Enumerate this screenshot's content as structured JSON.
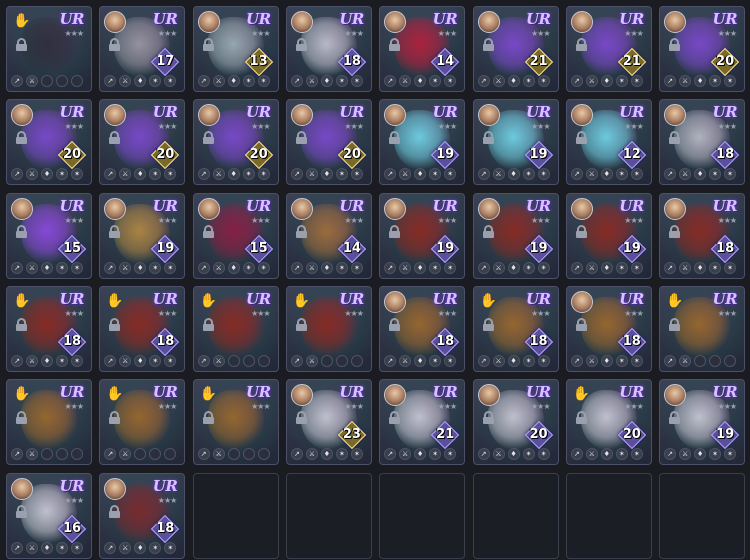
{
  "colors": {
    "background": "#1a1c21",
    "card_border": "#4a5168",
    "rarity_text": "#d9c2ff",
    "badge_purple": "#5a4f9c",
    "badge_gold": "#7a6a2a"
  },
  "items": [
    {
      "rarity": "UR",
      "level": "",
      "icon": "cat-mask-icon",
      "equipped": false,
      "badge": "none",
      "art": "#2b2f3a"
    },
    {
      "rarity": "UR",
      "level": "17",
      "icon": "winged-skull-icon",
      "equipped": true,
      "badge": "purple",
      "art": "#9a9aa4"
    },
    {
      "rarity": "UR",
      "level": "13",
      "icon": "silver-necklace-icon",
      "equipped": true,
      "badge": "gold",
      "art": "#9cb0b5"
    },
    {
      "rarity": "UR",
      "level": "18",
      "icon": "silver-ring-icon",
      "equipped": true,
      "badge": "purple",
      "art": "#bfc4cf"
    },
    {
      "rarity": "UR",
      "level": "14",
      "icon": "ruby-necklace-icon",
      "equipped": true,
      "badge": "purple",
      "art": "#b3203a"
    },
    {
      "rarity": "UR",
      "level": "21",
      "icon": "gem-ring-icon",
      "equipped": true,
      "badge": "gold",
      "art": "#7a4ad0"
    },
    {
      "rarity": "UR",
      "level": "21",
      "icon": "gem-ring-icon",
      "equipped": true,
      "badge": "gold",
      "art": "#7a4ad0"
    },
    {
      "rarity": "UR",
      "level": "20",
      "icon": "gem-ring-icon",
      "equipped": true,
      "badge": "gold",
      "art": "#7a4ad0"
    },
    {
      "rarity": "UR",
      "level": "20",
      "icon": "gem-ring-icon",
      "equipped": true,
      "badge": "gold",
      "art": "#7a4ad0"
    },
    {
      "rarity": "UR",
      "level": "20",
      "icon": "gem-ring-icon",
      "equipped": true,
      "badge": "gold",
      "art": "#7a4ad0"
    },
    {
      "rarity": "UR",
      "level": "20",
      "icon": "gem-ring-icon",
      "equipped": true,
      "badge": "gold",
      "art": "#7a4ad0"
    },
    {
      "rarity": "UR",
      "level": "20",
      "icon": "gem-ring-icon",
      "equipped": true,
      "badge": "gold",
      "art": "#7a4ad0"
    },
    {
      "rarity": "UR",
      "level": "19",
      "icon": "crystal-necklace-icon",
      "equipped": true,
      "badge": "purple",
      "art": "#6fd6e8"
    },
    {
      "rarity": "UR",
      "level": "19",
      "icon": "crystal-necklace-icon",
      "equipped": true,
      "badge": "purple",
      "art": "#6fd6e8"
    },
    {
      "rarity": "UR",
      "level": "12",
      "icon": "crystal-necklace-icon",
      "equipped": true,
      "badge": "purple",
      "art": "#6fd6e8"
    },
    {
      "rarity": "UR",
      "level": "18",
      "icon": "silver-gauntlet-icon",
      "equipped": true,
      "badge": "purple",
      "art": "#b8bcc6"
    },
    {
      "rarity": "UR",
      "level": "15",
      "icon": "purple-bracelet-icon",
      "equipped": true,
      "badge": "purple",
      "art": "#8a4ae0"
    },
    {
      "rarity": "UR",
      "level": "19",
      "icon": "gold-gauntlet-icon",
      "equipped": true,
      "badge": "purple",
      "art": "#b08a40"
    },
    {
      "rarity": "UR",
      "level": "15",
      "icon": "red-glove-icon",
      "equipped": true,
      "badge": "purple",
      "art": "#8a1e40"
    },
    {
      "rarity": "UR",
      "level": "14",
      "icon": "leather-glove-icon",
      "equipped": true,
      "badge": "purple",
      "art": "#a0703a"
    },
    {
      "rarity": "UR",
      "level": "19",
      "icon": "demon-helm-icon",
      "equipped": true,
      "badge": "purple",
      "art": "#8a2a1e"
    },
    {
      "rarity": "UR",
      "level": "19",
      "icon": "demon-helm-icon",
      "equipped": true,
      "badge": "purple",
      "art": "#8a2a1e"
    },
    {
      "rarity": "UR",
      "level": "19",
      "icon": "demon-helm-icon",
      "equipped": true,
      "badge": "purple",
      "art": "#8a2a1e"
    },
    {
      "rarity": "UR",
      "level": "18",
      "icon": "demon-helm-icon",
      "equipped": true,
      "badge": "purple",
      "art": "#8a2a1e"
    },
    {
      "rarity": "UR",
      "level": "18",
      "icon": "demon-helm-icon",
      "equipped": false,
      "badge": "purple",
      "art": "#8a2a1e"
    },
    {
      "rarity": "UR",
      "level": "18",
      "icon": "demon-helm-icon",
      "equipped": false,
      "badge": "purple",
      "art": "#8a2a1e"
    },
    {
      "rarity": "UR",
      "level": "",
      "icon": "demon-helm-icon",
      "equipped": false,
      "badge": "none",
      "art": "#8a2a1e"
    },
    {
      "rarity": "UR",
      "level": "",
      "icon": "demon-helm-icon",
      "equipped": false,
      "badge": "none",
      "art": "#8a2a1e"
    },
    {
      "rarity": "UR",
      "level": "18",
      "icon": "clawed-gauntlet-icon",
      "equipped": true,
      "badge": "purple",
      "art": "#9a6a2a"
    },
    {
      "rarity": "UR",
      "level": "18",
      "icon": "clawed-gauntlet-icon",
      "equipped": false,
      "badge": "purple",
      "art": "#9a6a2a"
    },
    {
      "rarity": "UR",
      "level": "18",
      "icon": "clawed-gauntlet-icon",
      "equipped": true,
      "badge": "purple",
      "art": "#9a6a2a"
    },
    {
      "rarity": "UR",
      "level": "",
      "icon": "clawed-gauntlet-icon",
      "equipped": false,
      "badge": "none",
      "art": "#9a6a2a"
    },
    {
      "rarity": "UR",
      "level": "",
      "icon": "clawed-gauntlet-icon",
      "equipped": false,
      "badge": "none",
      "art": "#9a6a2a"
    },
    {
      "rarity": "UR",
      "level": "",
      "icon": "clawed-gauntlet-icon",
      "equipped": false,
      "badge": "none",
      "art": "#9a6a2a"
    },
    {
      "rarity": "UR",
      "level": "",
      "icon": "clawed-gauntlet-icon",
      "equipped": false,
      "badge": "none",
      "art": "#9a6a2a"
    },
    {
      "rarity": "UR",
      "level": "23",
      "icon": "silver-gauntlet-icon",
      "equipped": true,
      "badge": "gold",
      "art": "#c8ccd6"
    },
    {
      "rarity": "UR",
      "level": "21",
      "icon": "silver-gauntlet-icon",
      "equipped": true,
      "badge": "purple",
      "art": "#c8ccd6"
    },
    {
      "rarity": "UR",
      "level": "20",
      "icon": "silver-gauntlet-icon",
      "equipped": true,
      "badge": "purple",
      "art": "#c8ccd6"
    },
    {
      "rarity": "UR",
      "level": "20",
      "icon": "silver-gauntlet-icon",
      "equipped": false,
      "badge": "purple",
      "art": "#c8ccd6"
    },
    {
      "rarity": "UR",
      "level": "19",
      "icon": "silver-gauntlet-icon",
      "equipped": true,
      "badge": "purple",
      "art": "#c8ccd6"
    },
    {
      "rarity": "UR",
      "level": "16",
      "icon": "silver-gauntlet-icon",
      "equipped": true,
      "badge": "purple",
      "art": "#c8ccd6"
    },
    {
      "rarity": "UR",
      "level": "18",
      "icon": "crimson-gauntlet-icon",
      "equipped": true,
      "badge": "purple",
      "art": "#7a2a2a"
    },
    {
      "rarity": "",
      "level": "",
      "icon": "",
      "equipped": false,
      "badge": "empty",
      "art": ""
    },
    {
      "rarity": "",
      "level": "",
      "icon": "",
      "equipped": false,
      "badge": "empty",
      "art": ""
    },
    {
      "rarity": "",
      "level": "",
      "icon": "",
      "equipped": false,
      "badge": "empty",
      "art": ""
    },
    {
      "rarity": "",
      "level": "",
      "icon": "",
      "equipped": false,
      "badge": "empty",
      "art": ""
    },
    {
      "rarity": "",
      "level": "",
      "icon": "",
      "equipped": false,
      "badge": "empty",
      "art": ""
    },
    {
      "rarity": "",
      "level": "",
      "icon": "",
      "equipped": false,
      "badge": "empty",
      "art": ""
    }
  ]
}
